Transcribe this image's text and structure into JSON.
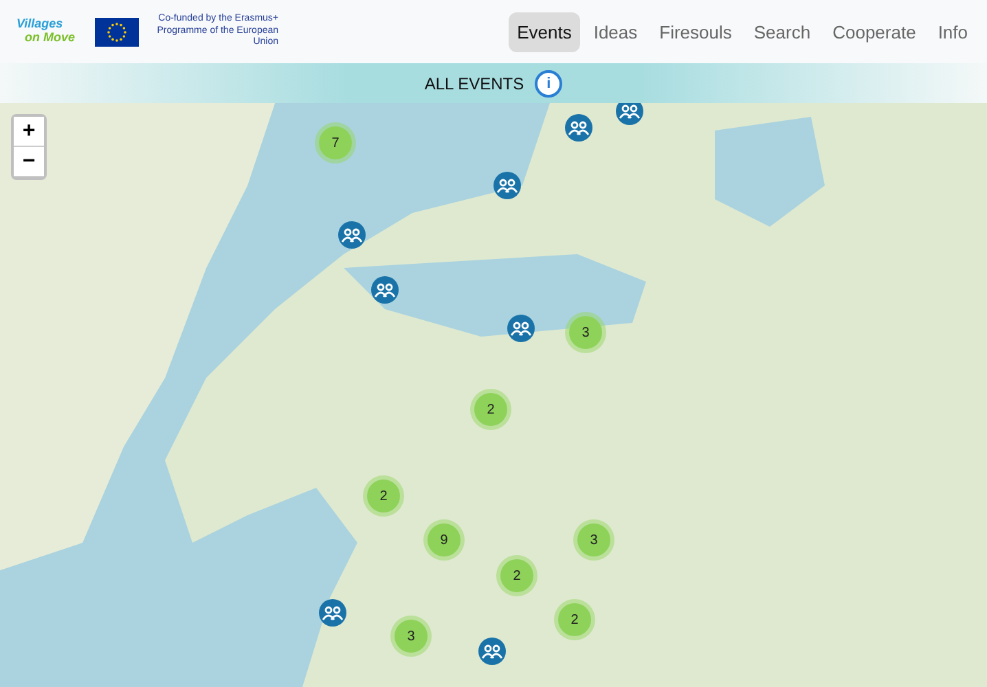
{
  "logo": {
    "line_1": "Villages",
    "line_2": "on Move"
  },
  "funding": {
    "text": "Co-funded by the Erasmus+ Programme of the European Union"
  },
  "nav": [
    {
      "label": "Events",
      "selected": true
    },
    {
      "label": "Ideas",
      "selected": false
    },
    {
      "label": "Firesouls",
      "selected": false
    },
    {
      "label": "Search",
      "selected": false
    },
    {
      "label": "Cooperate",
      "selected": false
    },
    {
      "label": "Info",
      "selected": false
    }
  ],
  "banner": {
    "title": "ALL EVENTS",
    "info_icon": "i"
  },
  "map": {
    "zoom_in": "+",
    "zoom_out": "−",
    "markers": [
      {
        "kind": "event"
      },
      {
        "kind": "cluster",
        "count": "7"
      },
      {
        "kind": "event"
      },
      {
        "kind": "event"
      },
      {
        "kind": "event"
      },
      {
        "kind": "event"
      },
      {
        "kind": "cluster",
        "count": "3"
      },
      {
        "kind": "event"
      },
      {
        "kind": "cluster",
        "count": "2"
      },
      {
        "kind": "cluster",
        "count": "2"
      },
      {
        "kind": "cluster",
        "count": "9"
      },
      {
        "kind": "cluster",
        "count": "3"
      },
      {
        "kind": "cluster",
        "count": "2"
      },
      {
        "kind": "event"
      },
      {
        "kind": "cluster",
        "count": "2"
      },
      {
        "kind": "cluster",
        "count": "3"
      },
      {
        "kind": "event"
      }
    ]
  }
}
